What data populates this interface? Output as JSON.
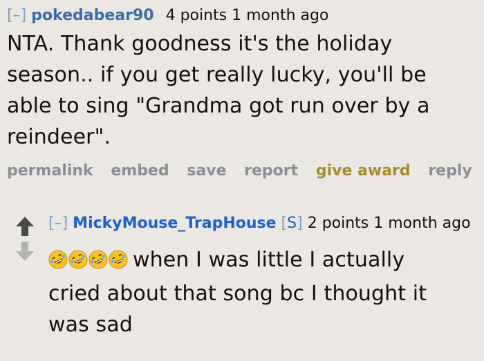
{
  "comment1": {
    "toggle": "[–]",
    "author": "pokedabear90",
    "score": "4 points 1 month ago",
    "lines": [
      "NTA. Thank goodness it's the holiday",
      "season.. if you get really lucky, you'll be",
      "able to sing \"Grandma got run over by a",
      "reindeer\"."
    ],
    "buttons": {
      "permalink": "permalink",
      "embed": "embed",
      "save": "save",
      "report": "report",
      "give_award": "give award",
      "reply": "reply"
    }
  },
  "comment2": {
    "toggle": "[–]",
    "author": "MickyMouse_TrapHouse",
    "flair_open": "[",
    "flair": "S",
    "flair_close": "]",
    "score": "2 points 1 month ago",
    "emojis": [
      "rofl-emoji",
      "rofl-emoji",
      "rofl-emoji",
      "rofl-emoji"
    ],
    "line1": "when I was little I actually",
    "line2": "cried about that song bc I thought it",
    "line3": "was sad"
  },
  "icons": {
    "up_arrow": "up-arrow-icon",
    "down_arrow": "down-arrow-icon"
  },
  "colors": {
    "background": "#ebe7e2",
    "author": "#3b6ea5",
    "op_author": "#1f5fc8",
    "toggle": "#7ba1c2",
    "buttons": "#8a8f96",
    "give_award": "#a48c2e",
    "arrow": "#4a4a4a",
    "downvote": "#b3b3b3"
  }
}
